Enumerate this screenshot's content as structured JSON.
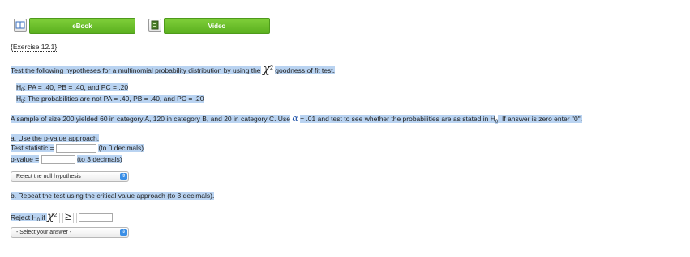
{
  "toolbar": {
    "ebook_label": "eBook",
    "video_label": "Video",
    "ebook_icon": "book-icon",
    "video_icon": "film-icon"
  },
  "exercise": {
    "label": "{Exercise 12.1}"
  },
  "intro": {
    "text": "Test the following hypotheses for a multinomial probability distribution by using the",
    "chi": "χ",
    "sup": "2",
    "text_after": "goodness of fit test."
  },
  "hyp": {
    "h0_prefix": "H",
    "h0_sub": "0",
    "h0_text": ": P",
    "h0_body": "A = .40, P",
    "h0_body2": "B = .40, and P",
    "h0_body3": "C = .20",
    "h0_full": ": PA = .40, PB = .40, and PC = .20",
    "ha_full": ": The probabilities are not PA = .40, PB = .40, and PC = .20"
  },
  "sample": {
    "text1": "A sample of size 200 yielded 60 in category A, 120 in category B, and 20 in category C. Use",
    "alpha": "α",
    "text2": "= .01 and test to see whether the probabilities are as stated in H",
    "sub": "0",
    "text3": ". If answer is zero enter \"0\"."
  },
  "part_a": {
    "heading": "a. Use the p-value approach.",
    "test_statistic_label": "Test statistic =",
    "test_statistic_value": "",
    "test_statistic_hint": "(to 0 decimals)",
    "pvalue_label": "p-value =",
    "pvalue_value": "",
    "pvalue_hint": "(to 3 decimals)",
    "select_value": "Reject the null hypothesis"
  },
  "part_b": {
    "heading": "b. Repeat the test using the critical value approach (to 3 decimals).",
    "reject_label": "Reject H",
    "reject_sub": "0",
    "reject_if": "if",
    "chi": "χ",
    "sup": "2",
    "relation": "≥",
    "critical_value": "",
    "select_value": "- Select your answer -"
  }
}
